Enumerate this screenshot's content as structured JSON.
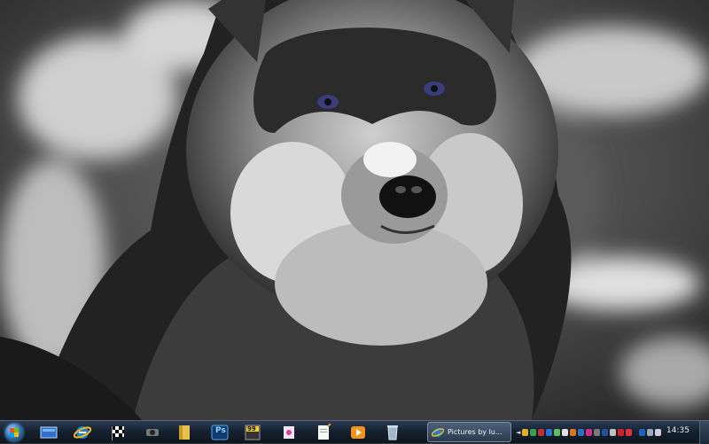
{
  "desktop": {
    "wallpaper_icon": "wolf-photo-wallpaper"
  },
  "taskbar": {
    "start_icon": "windows-orb-icon",
    "pinned": [
      {
        "name": "desktop-app-icon"
      },
      {
        "name": "internet-explorer-icon"
      },
      {
        "name": "checkered-flag-icon"
      },
      {
        "name": "webcam-icon"
      },
      {
        "name": "folder-icon"
      },
      {
        "name": "photoshop-icon",
        "label": "Ps"
      },
      {
        "name": "99-app-icon",
        "label": "99"
      },
      {
        "name": "paint-icon"
      },
      {
        "name": "notepad-icon"
      },
      {
        "name": "media-player-icon"
      },
      {
        "name": "recycle-bin-icon"
      }
    ],
    "active_task": {
      "label": "Pictures by lu...",
      "icon": "internet-explorer-icon"
    },
    "clock": "14:35"
  },
  "colors": {
    "accent": "#2a6db8"
  }
}
